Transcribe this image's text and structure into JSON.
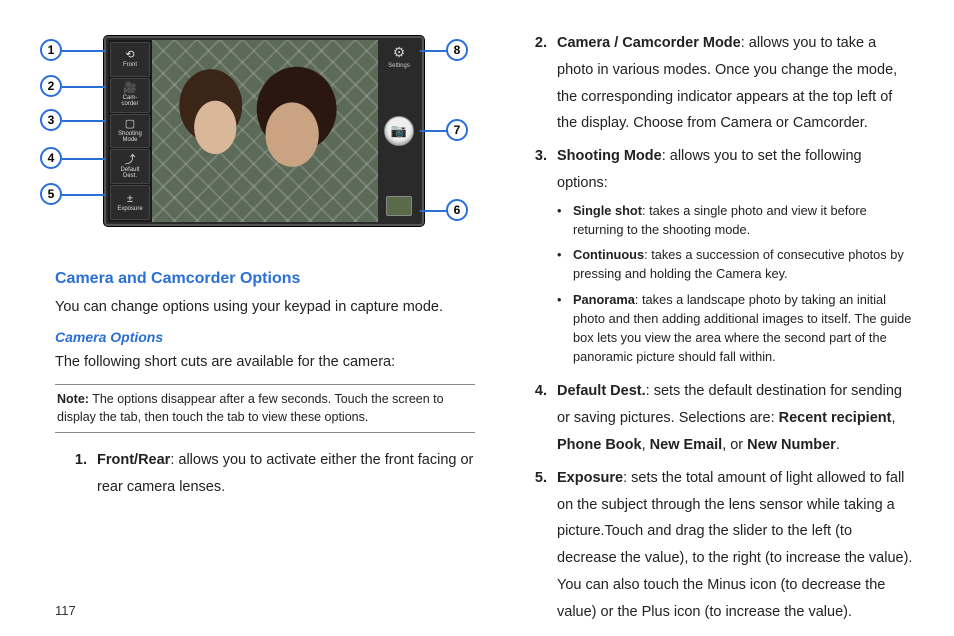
{
  "figure": {
    "strip": {
      "front_label": "Front",
      "camcorder_label": "Cam-\ncorder",
      "shooting_label": "Shooting\nMode",
      "default_label": "Default\nDest.",
      "exposure_label": "Exposure"
    },
    "settings_label": "Settings",
    "callouts": {
      "c1": "1",
      "c2": "2",
      "c3": "3",
      "c4": "4",
      "c5": "5",
      "c6": "6",
      "c7": "7",
      "c8": "8"
    }
  },
  "headings": {
    "main": "Camera and Camcorder Options",
    "sub": "Camera Options"
  },
  "intro": "You can change options using your keypad in capture mode.",
  "shortcuts_intro": "The following short cuts are available for the camera:",
  "note": {
    "label": "Note:",
    "body": " The options disappear after a few seconds. Touch the screen to display the tab, then touch the tab to view these options."
  },
  "items": {
    "i1": {
      "term": "Front/Rear",
      "rest": ": allows you to activate either the front facing or rear camera lenses."
    },
    "i2": {
      "term": "Camera / Camcorder Mode",
      "rest": ": allows you to take a photo in various modes. Once you change the mode, the corresponding indicator appears at the top left of the display. Choose from Camera or Camcorder."
    },
    "i3": {
      "term": "Shooting Mode",
      "rest": ": allows you to set the following options:"
    },
    "i4": {
      "term": "Default Dest.",
      "rest_a": ": sets the default destination for sending or saving pictures. Selections are: ",
      "opt1": "Recent recipient",
      "sep1": ", ",
      "opt2": "Phone Book",
      "sep2": ", ",
      "opt3": "New Email",
      "sep3": ", or ",
      "opt4": "New Number",
      "tail": "."
    },
    "i5": {
      "term": "Exposure",
      "rest": ": sets the total amount of light allowed to fall on the subject through the lens sensor while taking a picture.Touch and drag the slider to the left (to decrease the value), to the right (to increase the value). You can also touch the Minus icon (to decrease the value) or the Plus icon (to increase the value)."
    }
  },
  "bullets": {
    "b1": {
      "term": "Single shot",
      "rest": ": takes a single photo and view it before returning to the shooting mode."
    },
    "b2": {
      "term": "Continuous",
      "rest": ": takes a succession of consecutive photos by pressing and holding the Camera key."
    },
    "b3": {
      "term": "Panorama",
      "rest": ": takes a landscape photo by taking an initial photo and then adding additional images to itself. The guide box lets you view the area where the second part of the panoramic picture should fall within."
    }
  },
  "page": "117"
}
